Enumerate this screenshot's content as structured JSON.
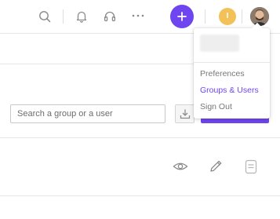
{
  "topbar": {
    "icons": [
      "search-icon",
      "bell-icon",
      "headset-icon",
      "more-icon",
      "plus-icon"
    ],
    "user_initial": "I"
  },
  "toolbar": {
    "search_placeholder": "Search a group or a user"
  },
  "row_actions": [
    "eye-icon",
    "pencil-icon",
    "trash-icon"
  ],
  "user_menu": {
    "items": [
      {
        "label": "Preferences",
        "active": false
      },
      {
        "label": "Groups & Users",
        "active": true
      },
      {
        "label": "Sign Out",
        "active": false
      }
    ]
  },
  "colors": {
    "accent": "#6f45f0",
    "initial_badge": "#f2c158",
    "menu_text": "#777777",
    "icon": "#8a8a8a"
  }
}
